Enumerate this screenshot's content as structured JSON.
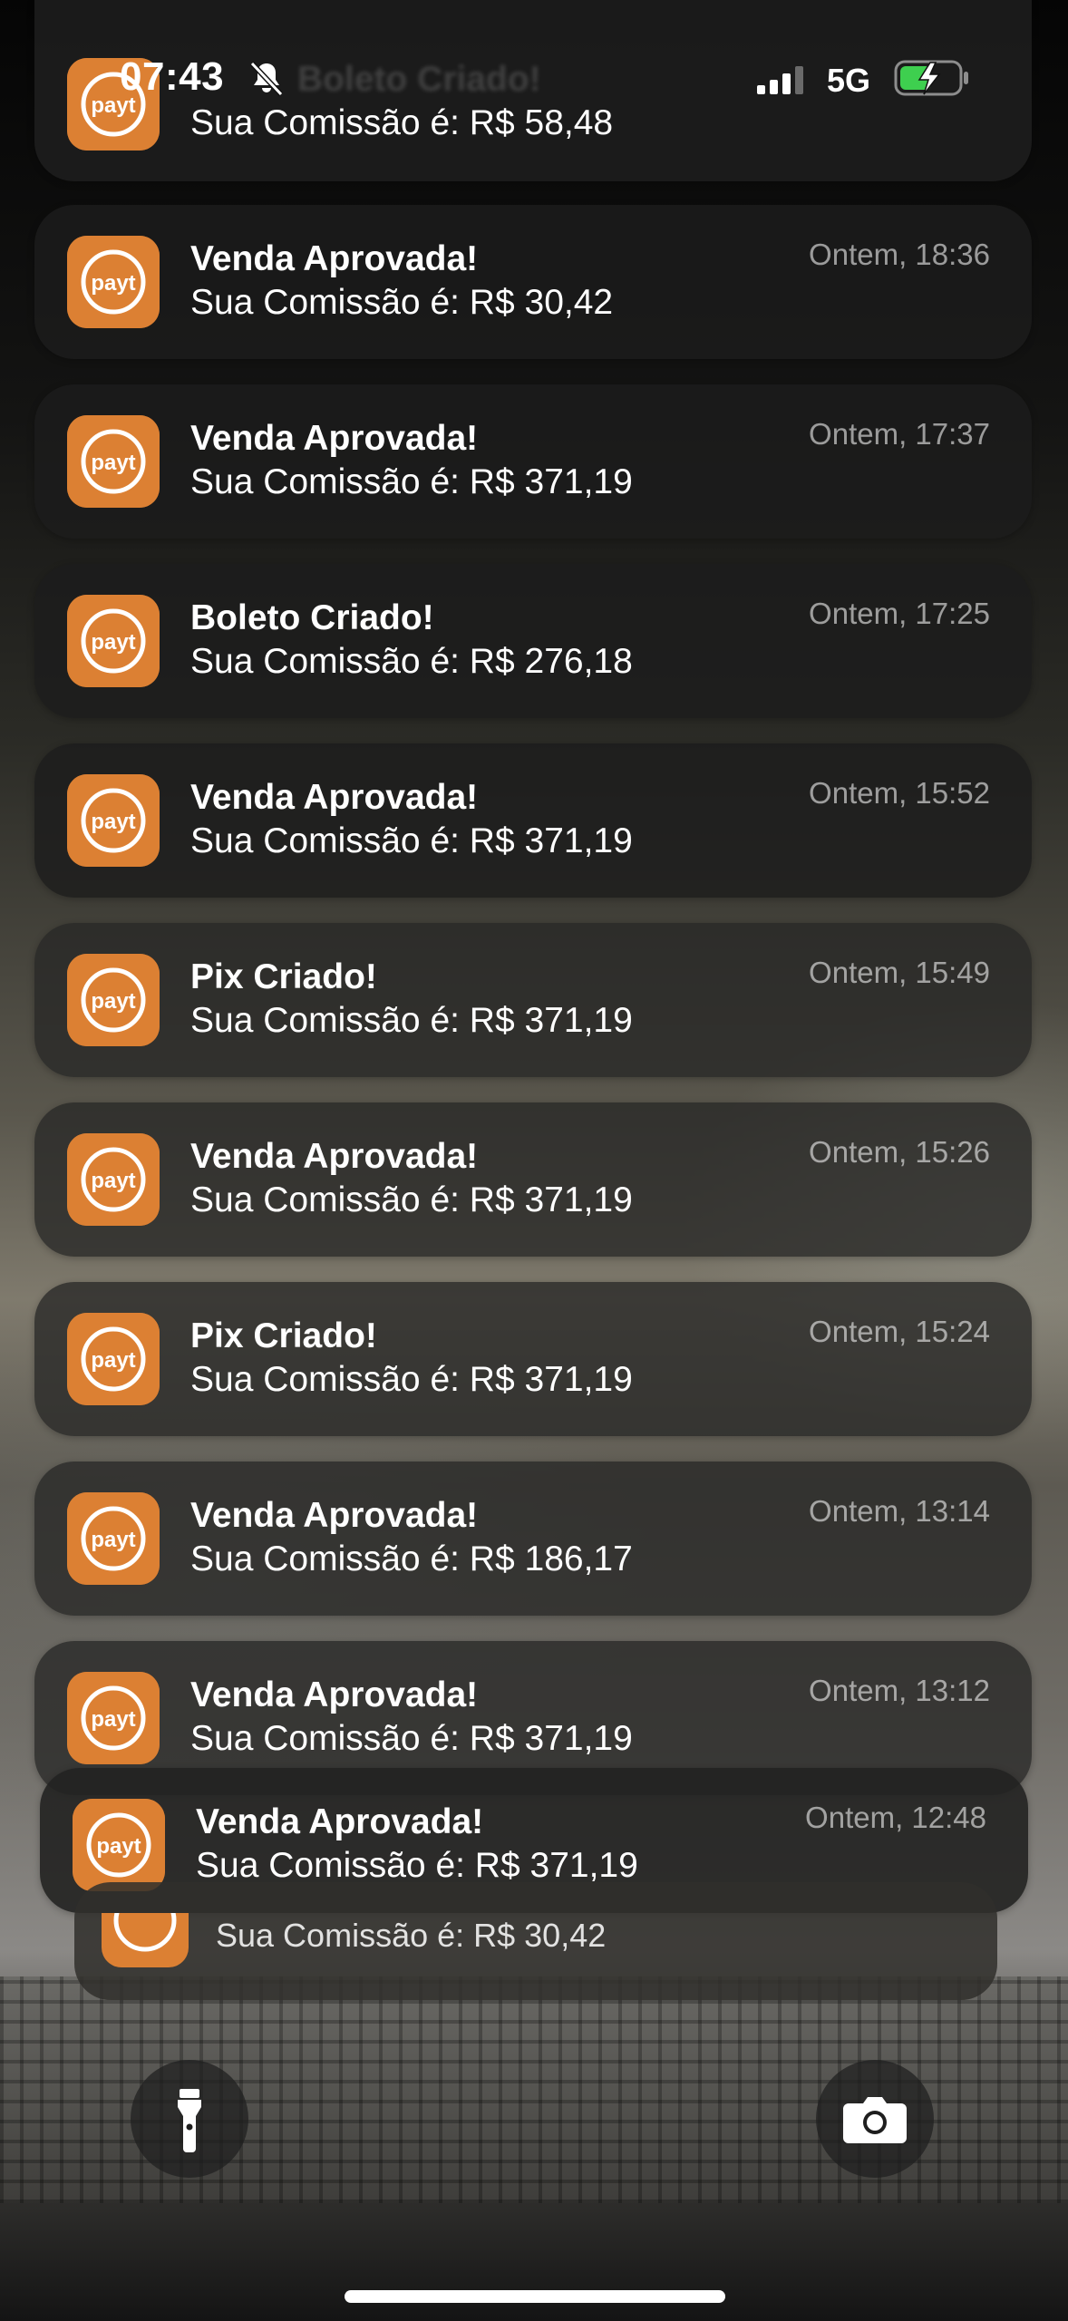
{
  "status_bar": {
    "time": "07:43",
    "network": "5G",
    "silent_mode": true,
    "charging": true
  },
  "top_stub": {
    "title": "Boleto Criado!",
    "body": "Sua Comissão é: R$ 58,48"
  },
  "notifications": [
    {
      "app_icon": "payt-logo",
      "title": "Venda Aprovada!",
      "body": "Sua Comissão é: R$ 30,42",
      "time": "Ontem, 18:36"
    },
    {
      "app_icon": "payt-logo",
      "title": "Venda Aprovada!",
      "body": "Sua Comissão é: R$ 371,19",
      "time": "Ontem, 17:37"
    },
    {
      "app_icon": "payt-logo",
      "title": "Boleto Criado!",
      "body": "Sua Comissão é: R$ 276,18",
      "time": "Ontem, 17:25"
    },
    {
      "app_icon": "payt-logo",
      "title": "Venda Aprovada!",
      "body": "Sua Comissão é: R$ 371,19",
      "time": "Ontem, 15:52"
    },
    {
      "app_icon": "payt-logo",
      "title": "Pix Criado!",
      "body": "Sua Comissão é: R$ 371,19",
      "time": "Ontem, 15:49"
    },
    {
      "app_icon": "payt-logo",
      "title": "Venda Aprovada!",
      "body": "Sua Comissão é: R$ 371,19",
      "time": "Ontem, 15:26"
    },
    {
      "app_icon": "payt-logo",
      "title": "Pix Criado!",
      "body": "Sua Comissão é: R$ 371,19",
      "time": "Ontem, 15:24"
    },
    {
      "app_icon": "payt-logo",
      "title": "Venda Aprovada!",
      "body": "Sua Comissão é: R$ 186,17",
      "time": "Ontem, 13:14"
    },
    {
      "app_icon": "payt-logo",
      "title": "Venda Aprovada!",
      "body": "Sua Comissão é: R$ 371,19",
      "time": "Ontem, 13:12"
    },
    {
      "app_icon": "payt-logo",
      "title": "Venda Aprovada!",
      "body": "Sua Comissão é: R$ 371,19",
      "time": "Ontem, 12:48"
    }
  ],
  "stack_back": {
    "body": "Sua Comissão é: R$ 30,42"
  },
  "quick_actions": {
    "left": "flashlight-icon",
    "right": "camera-icon"
  },
  "colors": {
    "app_icon_bg": "#dc8033",
    "card_bg": "#1c1c1c"
  }
}
